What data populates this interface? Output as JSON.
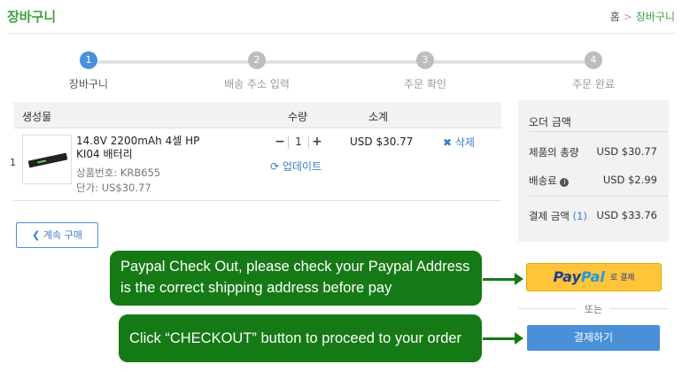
{
  "header": {
    "title": "장바구니",
    "breadcrumb": [
      "홈",
      "장바구니"
    ],
    "breadcrumb_sep": ">"
  },
  "steps": [
    {
      "num": "1",
      "label": "장바구니"
    },
    {
      "num": "2",
      "label": "배송 주소 입력"
    },
    {
      "num": "3",
      "label": "주문 확인"
    },
    {
      "num": "4",
      "label": "주문 완료"
    }
  ],
  "cart": {
    "columns": {
      "product": "생성물",
      "qty": "수량",
      "subtotal": "소계"
    },
    "items": [
      {
        "index": "1",
        "name": "14.8V 2200mAh 4셀 HP KI04 배터리",
        "code": "상품번호: KRB655",
        "unit_price": "단가: US$30.77",
        "quantity": "1",
        "update_label": "업데이트",
        "subtotal": "USD $30.77",
        "delete_label": "삭제"
      }
    ]
  },
  "continue_label": "계속 구매",
  "summary": {
    "title": "오더 금액",
    "product_total_label": "제품의 총량",
    "product_total": "USD $30.77",
    "shipping_label": "배송료",
    "shipping": "USD $2.99",
    "total_label": "결제 금액",
    "total_count": "(1)",
    "total": "USD $33.76"
  },
  "paypal": {
    "brand_a": "Pay",
    "brand_b": "Pal",
    "suffix": "로 결제"
  },
  "or_label": "또는",
  "checkout_label": "결제하기",
  "callouts": {
    "paypal_note": "Paypal Check Out, please check your Paypal Address is the correct shipping address before pay",
    "checkout_note": "Click “CHECKOUT” button to proceed to your order"
  },
  "colors": {
    "accent_green": "#3aa33a",
    "primary_blue": "#4a90d9",
    "callout_green": "#157a15",
    "paypal_yellow": "#ffc439"
  }
}
